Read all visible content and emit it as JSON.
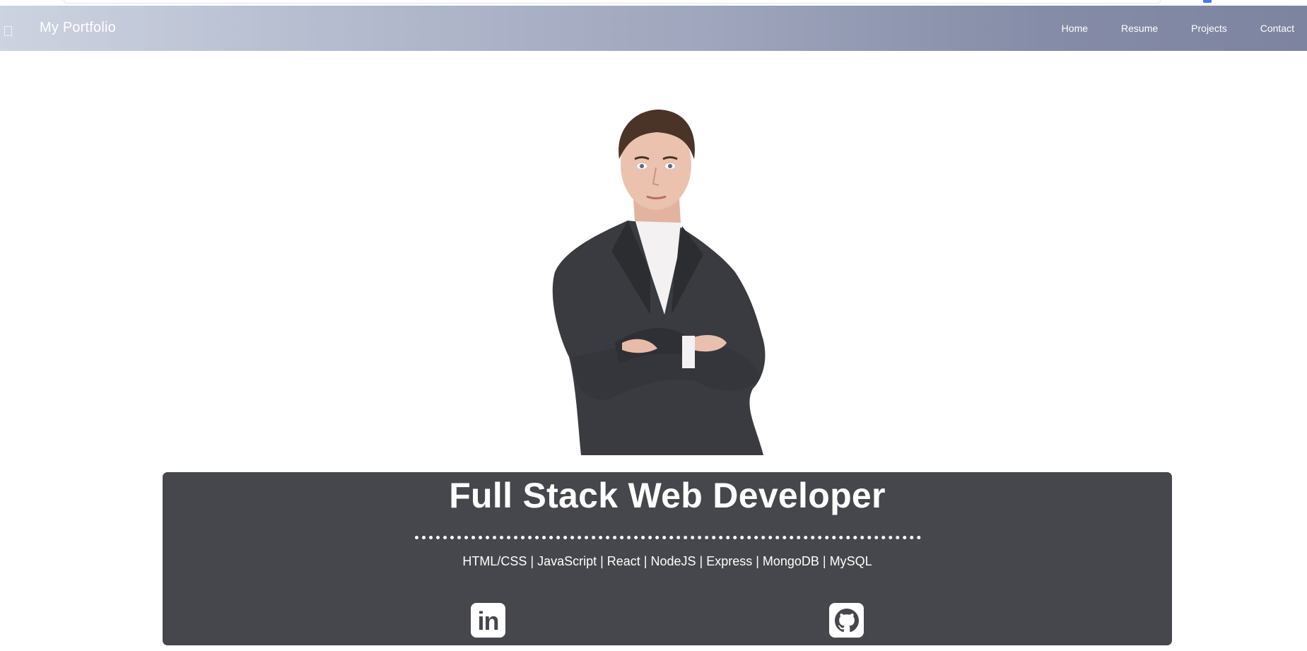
{
  "navbar": {
    "brand": "My Portfolio",
    "toggle_icon": "menu-icon",
    "links": [
      "Home",
      "Resume",
      "Projects",
      "Contact"
    ]
  },
  "hero": {
    "portrait_alt": "portrait-image",
    "title": "Full Stack Web Developer",
    "skills": "HTML/CSS | JavaScript | React | NodeJS | Express | MongoDB | MySQL",
    "social": {
      "linkedin_icon": "linkedin-icon",
      "github_icon": "github-icon"
    }
  },
  "colors": {
    "navbar_gradient_start": "#cdd3e0",
    "navbar_gradient_end": "#7d84a0",
    "hero_background": "#46474c",
    "text": "#ffffff"
  }
}
